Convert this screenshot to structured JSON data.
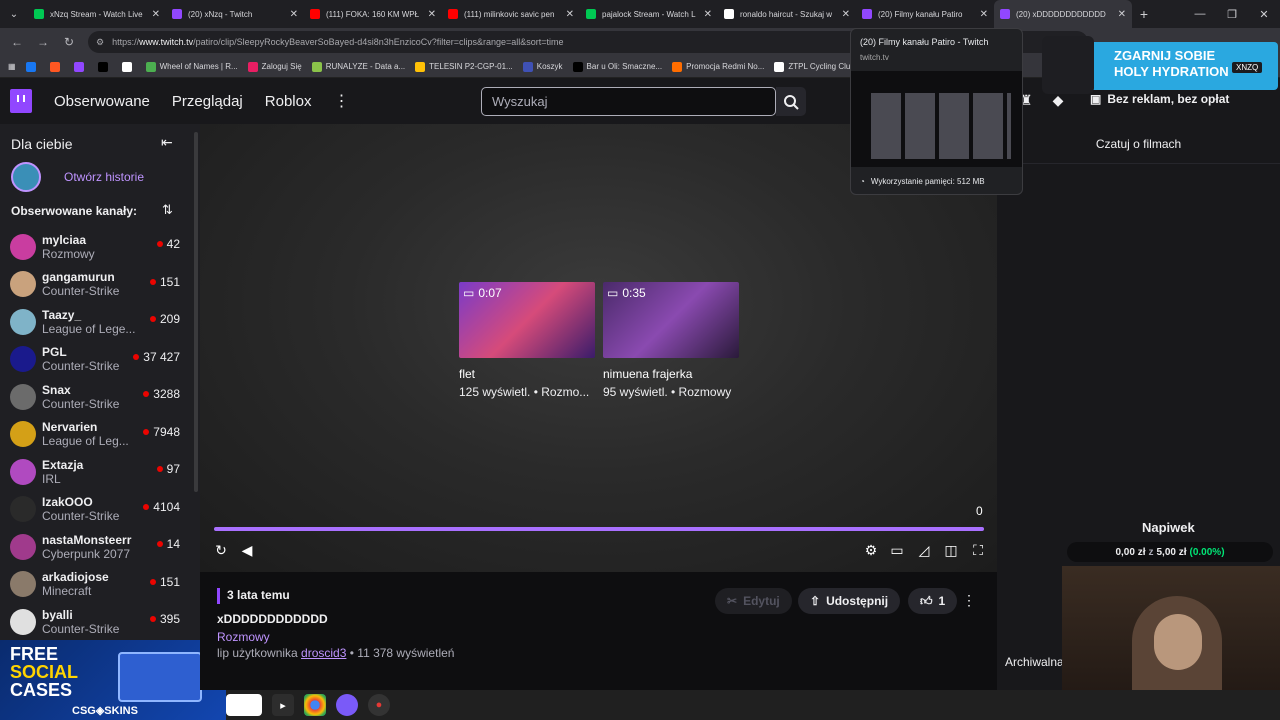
{
  "browser": {
    "tabs": [
      {
        "title": "xNzq Stream - Watch Live",
        "fav": "#00c853"
      },
      {
        "title": "(20) xNzq - Twitch",
        "fav": "#9147ff"
      },
      {
        "title": "(111) FOKA: 160 KM WPŁ",
        "fav": "#ff0000"
      },
      {
        "title": "(111) milinkovic savic pen",
        "fav": "#ff0000"
      },
      {
        "title": "pajalock Stream - Watch L",
        "fav": "#00c853"
      },
      {
        "title": "ronaldo haircut - Szukaj w",
        "fav": "#ffffff"
      },
      {
        "title": "(20) Filmy kanału Patiro",
        "fav": "#9147ff"
      },
      {
        "title": "(20) xDDDDDDDDDDDD",
        "fav": "#9147ff"
      }
    ],
    "url_prefix": "https://",
    "url_host": "www.twitch.tv",
    "url_path": "/patiro/clip/SleepyRockyBeaverSoBayed-d4si8n3hEnzicoCv?filter=clips&range=all&sort=time",
    "bookmarks": [
      {
        "label": "",
        "color": "#1877f2"
      },
      {
        "label": "",
        "color": "#ff5722"
      },
      {
        "label": "",
        "color": "#9147ff"
      },
      {
        "label": "",
        "color": "#000000"
      },
      {
        "label": "",
        "color": "#ffffff"
      },
      {
        "label": "Wheel of Names | R...",
        "color": "#4caf50"
      },
      {
        "label": "Zaloguj Się",
        "color": "#e91e63"
      },
      {
        "label": "RUNALYZE - Data a...",
        "color": "#8bc34a"
      },
      {
        "label": "TELESIN P2-CGP-01...",
        "color": "#ffc107"
      },
      {
        "label": "Koszyk",
        "color": "#3f51b5"
      },
      {
        "label": "Bar u Oli: Smaczne...",
        "color": "#000000"
      },
      {
        "label": "Promocja Redmi No...",
        "color": "#ff6d00"
      },
      {
        "label": "ZTPL Cycling Club",
        "color": "#ffffff"
      }
    ]
  },
  "tab_popup": {
    "title": "(20) Filmy kanału Patiro - Twitch",
    "url": "twitch.tv",
    "memory": "Wykorzystanie pamięci: 512 MB"
  },
  "top_ad": {
    "line1": "ZGARNIJ SOBIE",
    "line2": "HOLY HYDRATION",
    "tag": "XNZQ"
  },
  "header": {
    "nav_following": "Obserwowane",
    "nav_browse": "Przeglądaj",
    "nav_roblox": "Roblox",
    "search_placeholder": "Wyszukaj",
    "adfree": "Bez reklam, bez opłat"
  },
  "sidebar": {
    "title": "Dla ciebie",
    "history_link": "Otwórz historie",
    "followed_heading": "Obserwowane kanały:",
    "channels": [
      {
        "name": "mylciaa",
        "category": "Rozmowy",
        "viewers": "42",
        "color": "#c93da0"
      },
      {
        "name": "gangamurun",
        "category": "Counter-Strike",
        "viewers": "151",
        "color": "#c9a27d"
      },
      {
        "name": "Taazy_",
        "category": "League of Lege...",
        "viewers": "209",
        "color": "#7fb3c8"
      },
      {
        "name": "PGL",
        "category": "Counter-Strike",
        "viewers": "37 427",
        "color": "#1a1a8c"
      },
      {
        "name": "Snax",
        "category": "Counter-Strike",
        "viewers": "3288",
        "color": "#6b6b6b"
      },
      {
        "name": "Nervarien",
        "category": "League of Leg...",
        "viewers": "7948",
        "color": "#d4a017"
      },
      {
        "name": "Extazja",
        "category": "IRL",
        "viewers": "97",
        "color": "#b04ac0"
      },
      {
        "name": "IzakOOO",
        "category": "Counter-Strike",
        "viewers": "4104",
        "color": "#2a2a2a"
      },
      {
        "name": "nastaMonsteerr",
        "category": "Cyberpunk 2077",
        "viewers": "14",
        "color": "#a03a8c"
      },
      {
        "name": "arkadiojose",
        "category": "Minecraft",
        "viewers": "151",
        "color": "#8a7a6a"
      },
      {
        "name": "byalli",
        "category": "Counter-Strike",
        "viewers": "395",
        "color": "#e0e0e0"
      }
    ]
  },
  "ad_banner": {
    "line1": "FREE",
    "line2": "SOCIAL",
    "line3": "CASES",
    "brand": "CSG◈SKINS"
  },
  "player": {
    "clips": [
      {
        "duration": "0:07",
        "title": "flet",
        "meta": "125 wyświetl. • Rozmo..."
      },
      {
        "duration": "0:35",
        "title": "nimuena frajerka",
        "meta": "95 wyświetl. • Rozmowy"
      }
    ],
    "countdown": "0"
  },
  "clip_info": {
    "age": "3 lata temu",
    "title": "xDDDDDDDDDDDD",
    "category": "Rozmowy",
    "clipped_by_prefix": "lip użytkownika",
    "clipped_by_user": "droscid3",
    "views_suffix": "• 11 378 wyświetleń",
    "edit_label": "Edytuj",
    "share_label": "Udostępnij",
    "like_count": "1"
  },
  "chat": {
    "header": "Czatuj o filmach",
    "tip_title": "Napiwek",
    "tip_amount": "0,00 zł",
    "tip_of": "z",
    "tip_goal": "5,00 zł",
    "tip_pct": "(0.00%)",
    "archive_label": "Archiwalna"
  }
}
